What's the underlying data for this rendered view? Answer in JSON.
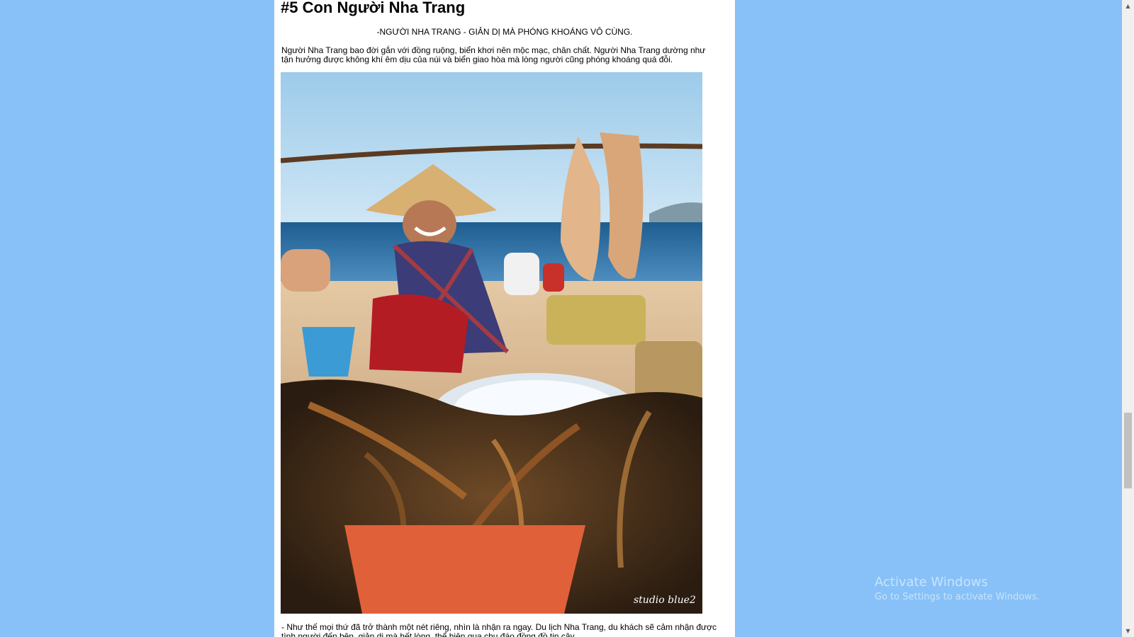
{
  "article": {
    "heading": "#5 Con Người Nha Trang",
    "subtitle": "-NGƯỜI NHA TRANG - GIẢN DỊ MÀ PHÓNG KHOÁNG VÔ CÙNG.",
    "paragraph": "Người Nha Trang bao đời gắn với đồng ruộng, biển khơi nên mộc mạc, chân chất. Người Nha Trang dường như tận hưởng được không khí êm dịu của núi và biển giao hòa mà lòng người cũng phóng khoáng quá đỗi.",
    "photo_signature": "studio blue2",
    "next_paragraph": "- Như thế mọi thứ đã trở thành một nét riêng, nhìn là nhận ra ngay. Du lịch Nha Trang, du khách sẽ cảm nhận được tình người đến bên, giản dị mà hết lòng, thể hiện qua chu đáo đồng đồ tin cậy."
  },
  "watermark": {
    "title": "Activate Windows",
    "subtitle": "Go to Settings to activate Windows."
  },
  "scrollbar": {
    "up_icon": "chevron-up-icon",
    "down_icon": "chevron-down-icon"
  },
  "colors": {
    "page_background": "#87c1f8",
    "content_background": "#ffffff",
    "text": "#000000"
  }
}
